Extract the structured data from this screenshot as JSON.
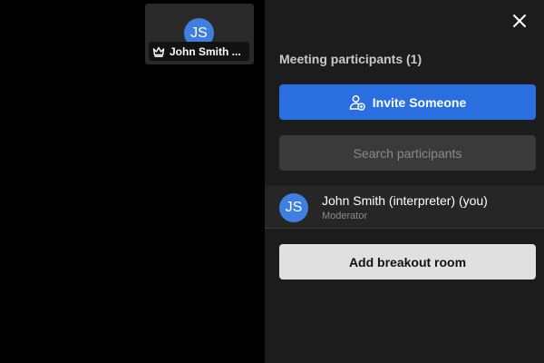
{
  "video_tile": {
    "avatar_initials": "JS",
    "name": "John Smith ...",
    "role_icon": "crown-icon"
  },
  "panel": {
    "close_icon": "close-icon",
    "title": "Meeting participants (1)",
    "invite_button_label": "Invite Someone",
    "invite_icon": "add-person-icon",
    "search_placeholder": "Search participants",
    "search_value": "",
    "participants": [
      {
        "initials": "JS",
        "name": "John Smith (interpreter) (you)",
        "role": "Moderator"
      }
    ],
    "breakout_button_label": "Add breakout room"
  },
  "colors": {
    "accent": "#2a6fe0",
    "avatar": "#3f7fe0",
    "panel_bg": "#1c1c1c",
    "stage_bg": "#000000"
  }
}
